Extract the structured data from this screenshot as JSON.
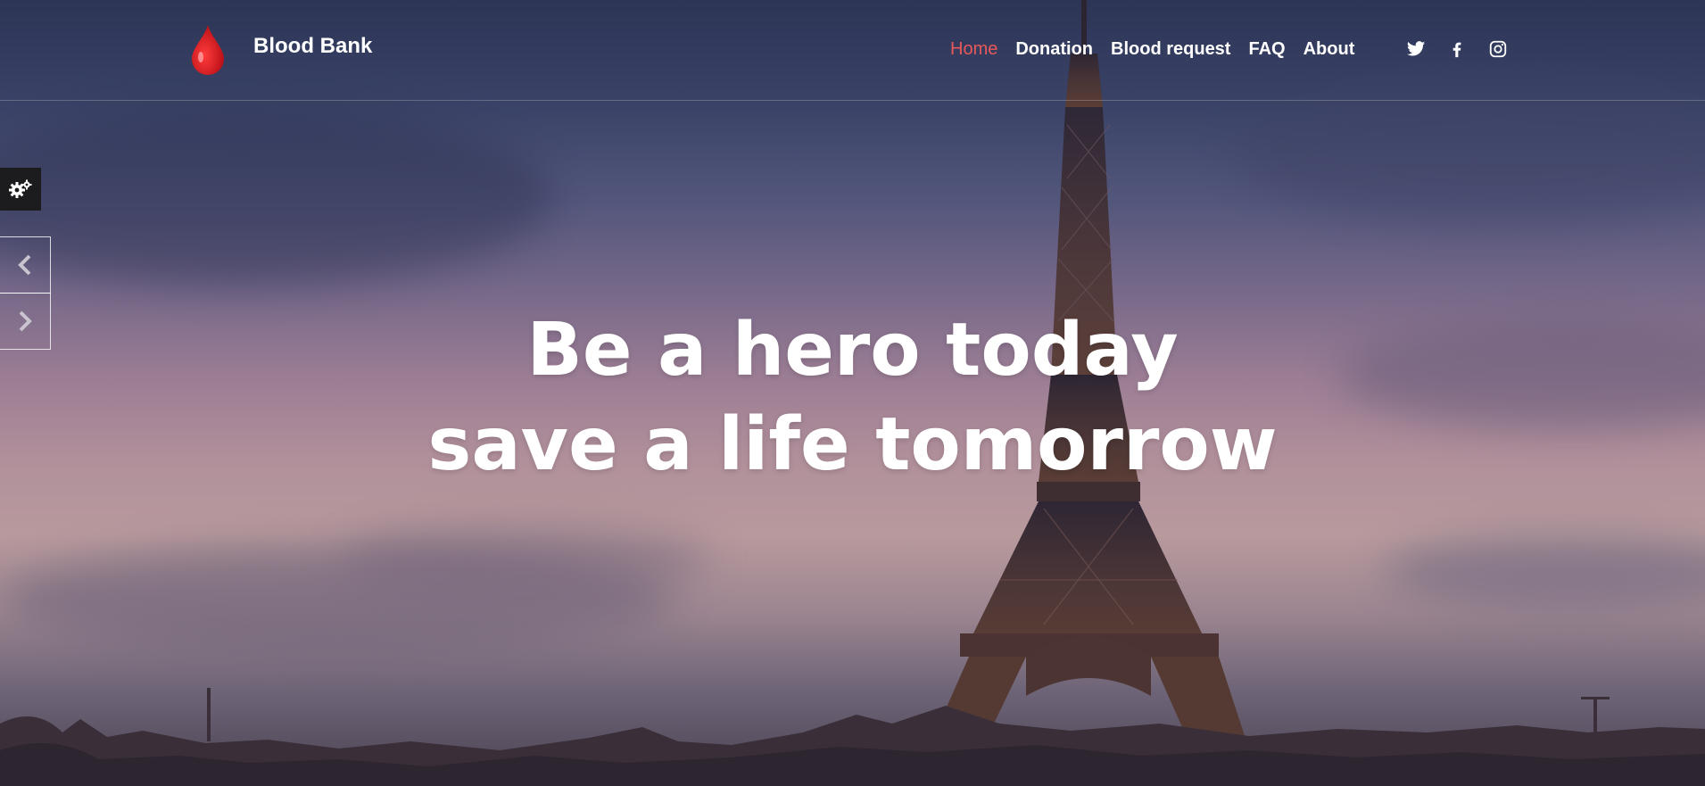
{
  "header": {
    "brand": "Blood Bank",
    "logo_icon": "blood-drop-icon",
    "nav": [
      {
        "label": "Home",
        "active": true
      },
      {
        "label": "Donation",
        "active": false
      },
      {
        "label": "Blood request",
        "active": false
      },
      {
        "label": "FAQ",
        "active": false
      },
      {
        "label": "About",
        "active": false
      }
    ],
    "social": [
      "twitter-icon",
      "facebook-icon",
      "instagram-icon"
    ]
  },
  "hero": {
    "line1": "Be a hero today",
    "line2": "save a life tomorrow"
  },
  "controls": {
    "settings_icon": "gears-icon",
    "prev_icon": "chevron-left-icon",
    "next_icon": "chevron-right-icon"
  },
  "colors": {
    "accent": "#e8585a",
    "text": "#ffffff",
    "settings_bg": "#1c1c1e"
  }
}
